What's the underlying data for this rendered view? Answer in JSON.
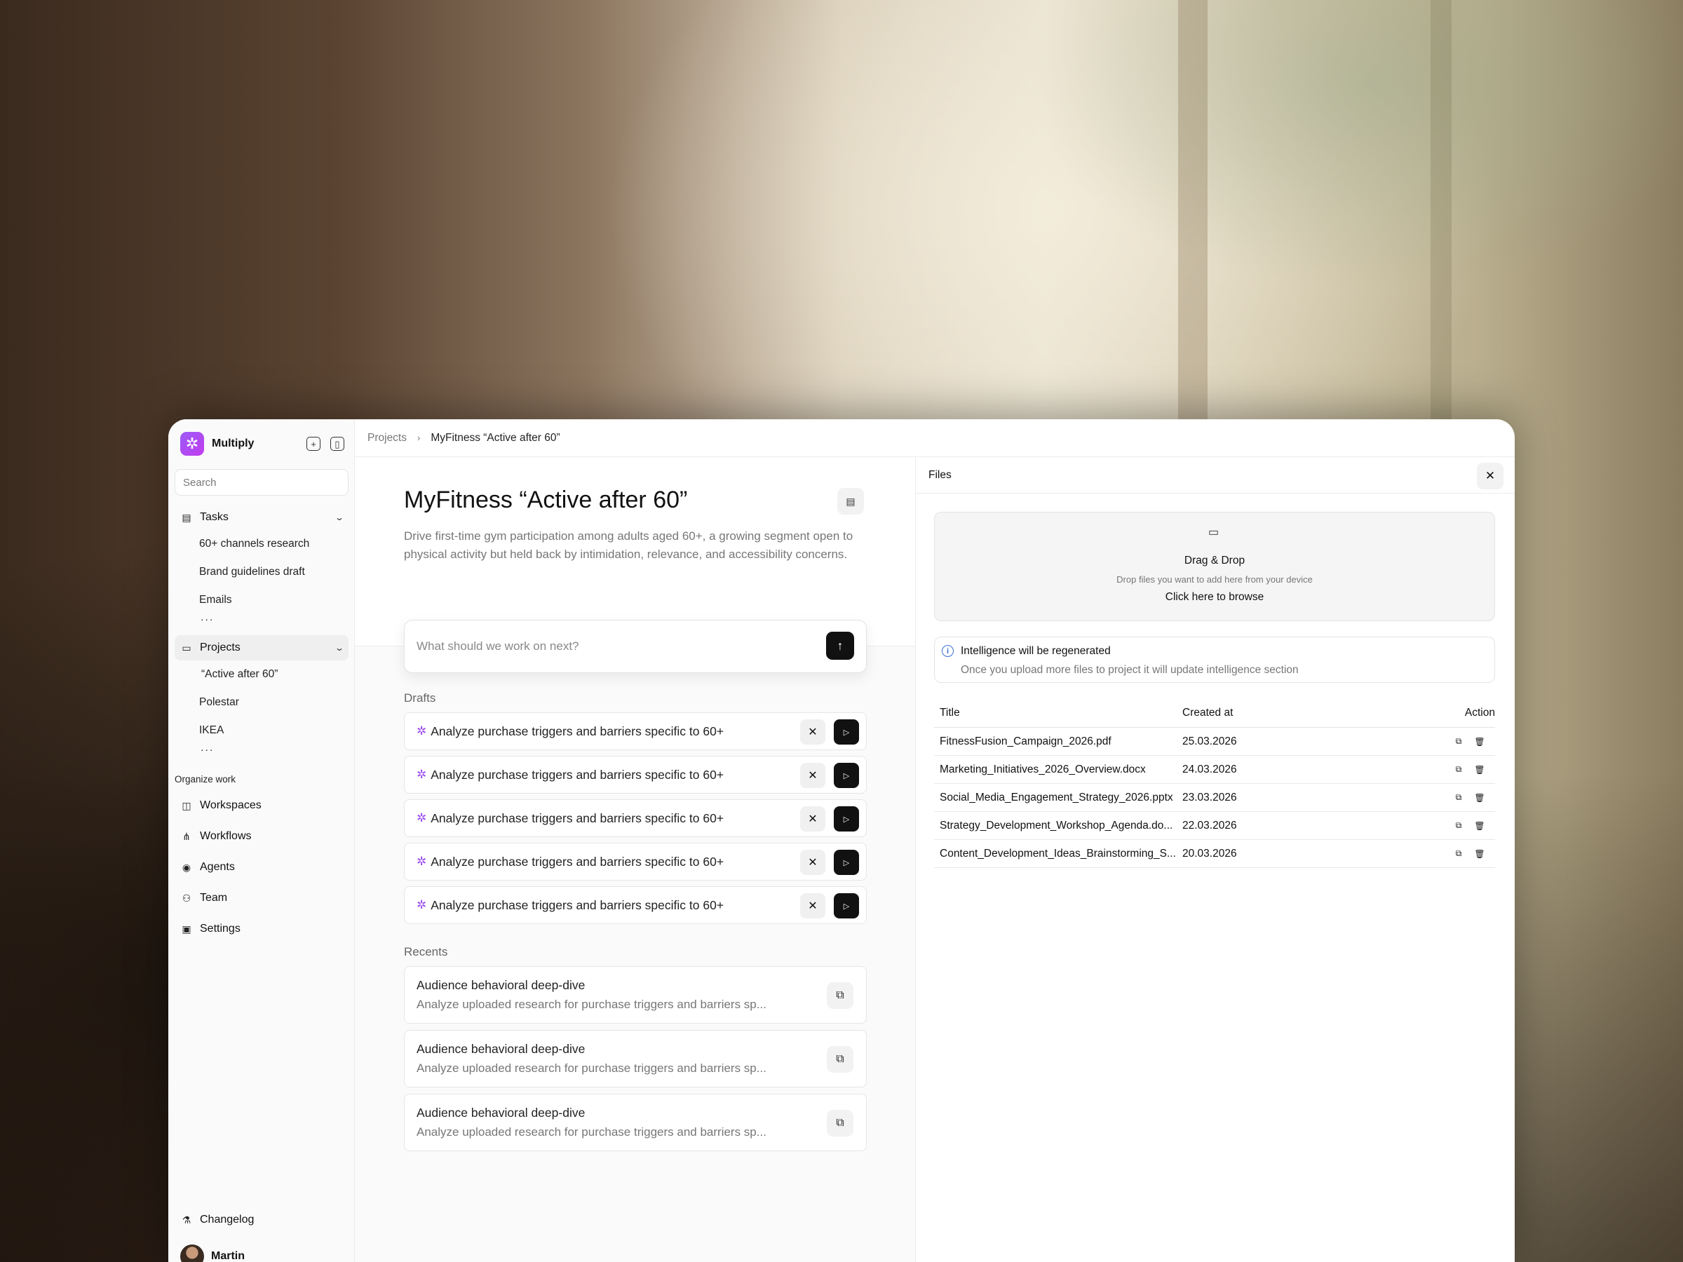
{
  "sidebar": {
    "brand": "Multiply",
    "search_placeholder": "Search",
    "tasks": {
      "label": "Tasks",
      "items": [
        "60+ channels research",
        "Brand guidelines draft",
        "Emails"
      ],
      "more": "..."
    },
    "projects": {
      "label": "Projects",
      "items": [
        "“Active after 60”",
        "Polestar",
        "IKEA"
      ],
      "more": "..."
    },
    "organize_label": "Organize work",
    "organize_items": [
      "Workspaces",
      "Workflows",
      "Agents",
      "Team",
      "Settings"
    ],
    "changelog": "Changelog",
    "user": "Martin"
  },
  "breadcrumb": {
    "parent": "Projects",
    "current": "MyFitness “Active after 60”"
  },
  "project": {
    "title": "MyFitness “Active after 60”",
    "description": "Drive first-time gym participation among adults aged 60+, a growing segment open to physical activity but held back by intimidation, relevance, and accessibility concerns.",
    "prompt_placeholder": "What should we work on next?"
  },
  "drafts": {
    "label": "Drafts",
    "items": [
      "Analyze purchase triggers and barriers specific to 60+",
      "Analyze purchase triggers and barriers specific to 60+",
      "Analyze purchase triggers and barriers specific to 60+",
      "Analyze purchase triggers and barriers specific to 60+",
      "Analyze purchase triggers and barriers specific to 60+"
    ]
  },
  "recents": {
    "label": "Recents",
    "items": [
      {
        "title": "Audience behavioral deep-dive",
        "subtitle": "Analyze uploaded research for purchase triggers and barriers sp..."
      },
      {
        "title": "Audience behavioral deep-dive",
        "subtitle": "Analyze uploaded research for purchase triggers and barriers sp..."
      },
      {
        "title": "Audience behavioral deep-dive",
        "subtitle": "Analyze uploaded research for purchase triggers and barriers sp..."
      }
    ]
  },
  "files": {
    "title": "Files",
    "dropzone": {
      "title": "Drag & Drop",
      "subtitle": "Drop files you want to add here from your device",
      "link": "Click here to browse"
    },
    "notice": {
      "title": "Intelligence will be regenerated",
      "subtitle": "Once you upload more files to project it will update intelligence section"
    },
    "columns": {
      "title": "Title",
      "created": "Created at",
      "action": "Action"
    },
    "rows": [
      {
        "title": "FitnessFusion_Campaign_2026.pdf",
        "created": "25.03.2026"
      },
      {
        "title": "Marketing_Initiatives_2026_Overview.docx",
        "created": "24.03.2026"
      },
      {
        "title": "Social_Media_Engagement_Strategy_2026.pptx",
        "created": "23.03.2026"
      },
      {
        "title": "Strategy_Development_Workshop_Agenda.do...",
        "created": "22.03.2026"
      },
      {
        "title": "Content_Development_Ideas_Brainstorming_S...",
        "created": "20.03.2026"
      }
    ]
  },
  "colors": {
    "brand": "#9b5cf6",
    "primary_button": "#111111",
    "info": "#3b6fd6"
  }
}
